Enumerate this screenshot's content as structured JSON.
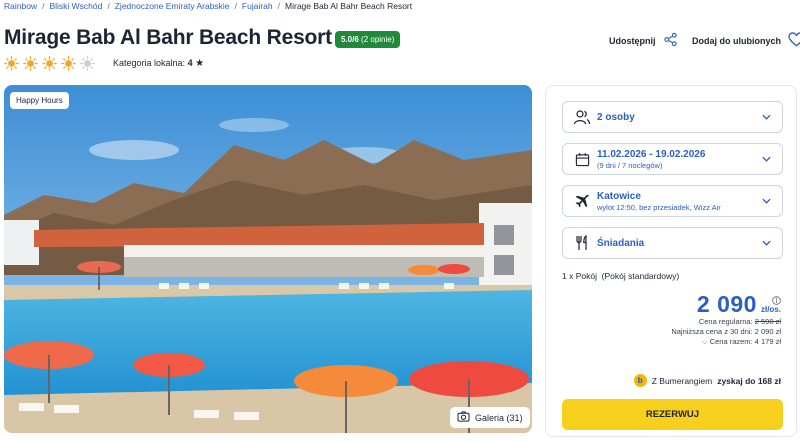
{
  "breadcrumb": [
    "Rainbow",
    "Bliski Wschód",
    "Zjednoczone Emiraty Arabskie",
    "Fujairah",
    "Mirage Bab Al Bahr Beach Resort"
  ],
  "hotel": {
    "name": "Mirage Bab Al Bahr Beach Resort",
    "rating": "5.0/6",
    "rating_count": "(2 opinie)",
    "suns_filled": 4,
    "suns_total": 5,
    "category_label": "Kategoria lokalna:",
    "category_value": "4"
  },
  "actions": {
    "share": "Udostępnij",
    "favorite": "Dodaj do ulubionych"
  },
  "photo": {
    "badge": "Happy Hours",
    "gallery": "Galeria (31)"
  },
  "booking": {
    "persons": "2 osoby",
    "dates": "11.02.2026 - 19.02.2026",
    "dates_sub": "(9 dni / 7 noclegów)",
    "departure": "Katowice",
    "departure_sub": "wylot 12:50, bez przesiadek, Wizz Air",
    "meals": "Śniadania",
    "room": "1 x Pokój  (Pokój standardowy)",
    "price": "2 090",
    "price_unit": "zł/os.",
    "regular_label": "Cena regularna:",
    "regular_value": "2 590 zł",
    "lowest_label": "Najniższa cena z 30 dni:",
    "lowest_value": "2 090 zł",
    "total_label": "Cena razem:",
    "total_value": "4 179 zł",
    "bumerang_text": "Z Bumerangiem",
    "bumerang_value": "zyskaj do 168 zł",
    "reserve": "REZERWUJ"
  },
  "colors": {
    "accent": "#2a5fc7",
    "rating": "#1f8a3a",
    "reserve": "#f7cf1d",
    "sun": "#f5a623"
  }
}
